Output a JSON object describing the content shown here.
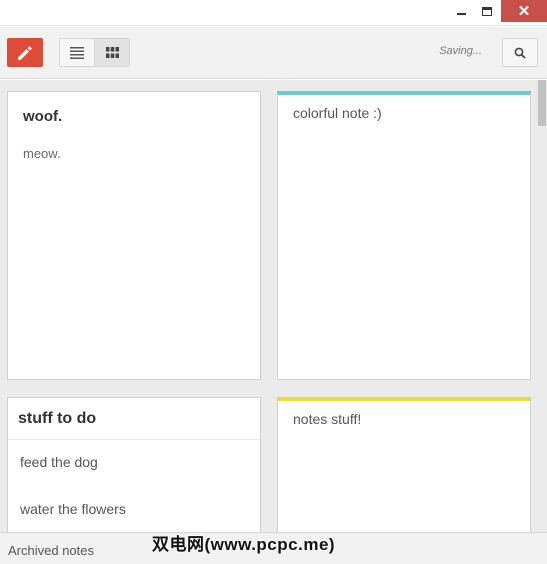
{
  "window": {
    "close_glyph": "✕"
  },
  "toolbar": {
    "status": "Saving..."
  },
  "notes": [
    {
      "title": "woof.",
      "body": "meow."
    },
    {
      "title": "",
      "body": "colorful note :)",
      "color": "#6cc6d4"
    },
    {
      "title": "stuff to do",
      "items": [
        "feed the dog",
        "water the flowers"
      ]
    },
    {
      "title": "",
      "body": "notes stuff!",
      "color": "#ecdd38"
    }
  ],
  "footer": {
    "archived_label": "Archived notes"
  },
  "watermark": "双电网(www.pcpc.me)",
  "colors": {
    "accent": "#dd4b39",
    "teal_note": "#6cc6d4",
    "yellow_note": "#ecdd38",
    "close_button": "#c7504a"
  }
}
